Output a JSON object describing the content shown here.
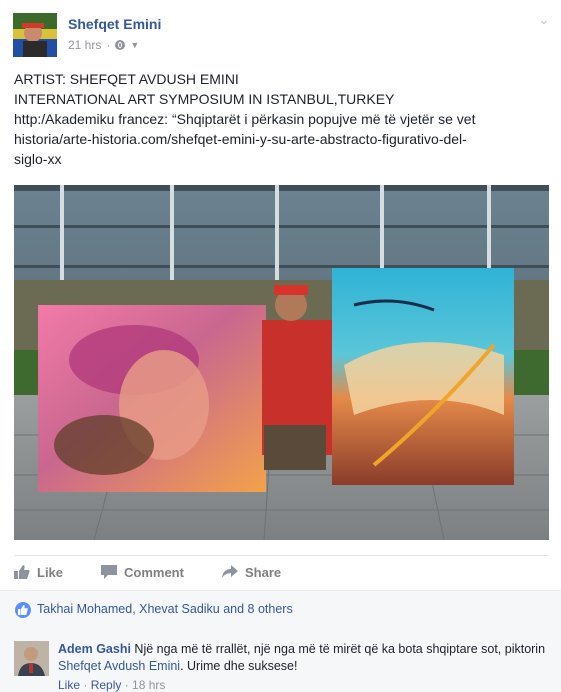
{
  "post": {
    "author": "Shefqet Emini",
    "time": "21 hrs",
    "body_lines": [
      "ARTIST: SHEFQET AVDUSH EMINI",
      "INTERNATIONAL ART SYMPOSIUM IN ISTANBUL,TURKEY",
      "http:/Akademiku francez: “Shqiptarët i përkasin popujve më të vjetër se vet",
      "historia/arte-historia.com/shefqet-emini-y-su-arte-abstracto-figurativo-del-",
      "siglo-xx"
    ]
  },
  "actions": {
    "like": "Like",
    "comment": "Comment",
    "share": "Share"
  },
  "reactions": {
    "text": "Takhai Mohamed, Xhevat Sadiku and 8 others"
  },
  "comment": {
    "name": "Adem Gashi",
    "text_a": " Një nga më të rrallët, një nga më të mirët që ka bota shqiptare sot, piktorin ",
    "link": "Shefqet Avdush Emini",
    "text_b": ". Urime dhe suksese!",
    "like": "Like",
    "sep": " · ",
    "reply": "Reply",
    "time": "18 hrs"
  },
  "colors": {
    "link": "#365899",
    "muted": "#90949c",
    "like_blue": "#5890ff"
  }
}
